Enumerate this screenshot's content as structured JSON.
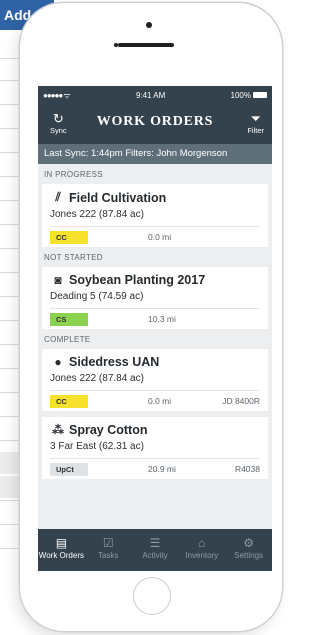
{
  "background": {
    "header_text": "Add"
  },
  "status_bar": {
    "signal": "●●●●● ",
    "wifi": "ᯤ",
    "time": "9:41 AM",
    "battery": "100%"
  },
  "nav": {
    "title": "WORK ORDERS",
    "sync_label": "Sync",
    "sync_icon": "↻",
    "filter_label": "Filter",
    "filter_icon": "⏷"
  },
  "sync_bar": {
    "text": "Last Sync: 1:44pm  Filters: John Morgenson"
  },
  "sections": [
    {
      "label": "IN PROGRESS",
      "items": [
        {
          "icon": "cultivator-icon",
          "glyph": "⫽",
          "name": "Field Cultivation",
          "field": "Jones 222 (87.84 ac)",
          "badge": "CC",
          "badge_color": "#f6e12c",
          "distance": "0.0 mi",
          "equipment": ""
        }
      ]
    },
    {
      "label": "NOT STARTED",
      "items": [
        {
          "icon": "seed-bag-icon",
          "glyph": "◙",
          "name": "Soybean Planting 2017",
          "field": "Deading 5 (74.59 ac)",
          "badge": "CS",
          "badge_color": "#8bd34f",
          "distance": "10.3 mi",
          "equipment": ""
        }
      ]
    },
    {
      "label": "COMPLETE",
      "items": [
        {
          "icon": "fertilizer-icon",
          "glyph": "●",
          "name": "Sidedress UAN",
          "field": "Jones 222 (87.84 ac)",
          "badge": "CC",
          "badge_color": "#f6e12c",
          "distance": "0.0 mi",
          "equipment": "JD 8400R"
        },
        {
          "icon": "sprayer-icon",
          "glyph": "⁂",
          "name": "Spray Cotton",
          "field": "3 Far East (62.31 ac)",
          "badge": "UpCt",
          "badge_color": "#dfe2e5",
          "distance": "20.9 mi",
          "equipment": "R4038"
        }
      ]
    }
  ],
  "tabs": [
    {
      "label": "Work Orders",
      "icon": "clipboard-icon",
      "glyph": "▤",
      "active": true
    },
    {
      "label": "Tasks",
      "icon": "checklist-icon",
      "glyph": "☑",
      "active": false
    },
    {
      "label": "Activity",
      "icon": "activity-list-icon",
      "glyph": "☰",
      "active": false
    },
    {
      "label": "Inventory",
      "icon": "barn-icon",
      "glyph": "⌂",
      "active": false
    },
    {
      "label": "Settings",
      "icon": "gear-icon",
      "glyph": "⚙",
      "active": false
    }
  ]
}
